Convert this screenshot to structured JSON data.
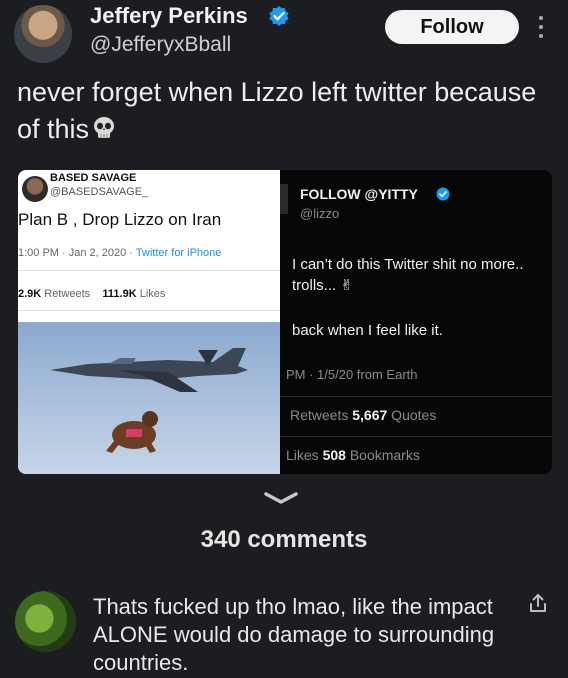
{
  "post": {
    "author_name": "Jeffery Perkins",
    "author_handle": "@JefferyxBball",
    "follow_label": "Follow",
    "text": "never forget when Lizzo left twitter because of this",
    "text_emoji": "💀"
  },
  "embedded_image": {
    "left_tweet": {
      "name": "BASED SAVAGE",
      "handle": "@BASEDSAVAGE_",
      "text": "Plan B , Drop Lizzo on Iran",
      "meta_time": "1:00 PM · Jan 2, 2020 · ",
      "meta_source": "Twitter for iPhone",
      "retweets_value": "2.9K",
      "retweets_label": " Retweets",
      "likes_value": "111.9K",
      "likes_label": " Likes"
    },
    "right_tweet": {
      "name": "FOLLOW @YITTY",
      "handle": "@lizzo",
      "line1": "I can’t do this Twitter shit no more..",
      "line2": "trolls... ✌",
      "line3": "back when I feel like it.",
      "meta": "PM · 1/5/20 from Earth",
      "retweets_label": "Retweets ",
      "quotes_value": "5,667",
      "quotes_label": " Quotes",
      "likes_label": "Likes ",
      "bookmarks_value": "508",
      "bookmarks_label": " Bookmarks"
    }
  },
  "comments": {
    "count_label": "340 comments"
  },
  "top_comment": {
    "text": "Thats fucked up tho lmao, like the impact ALONE would do damage to surrounding countries."
  },
  "colors": {
    "background": "#1c1d20",
    "verified_blue": "#1d9bf0",
    "follow_button_bg": "#f4f4f4"
  },
  "icons": [
    "verified-badge-icon",
    "more-options-icon",
    "skull-icon",
    "chevron-down-icon",
    "share-icon"
  ]
}
